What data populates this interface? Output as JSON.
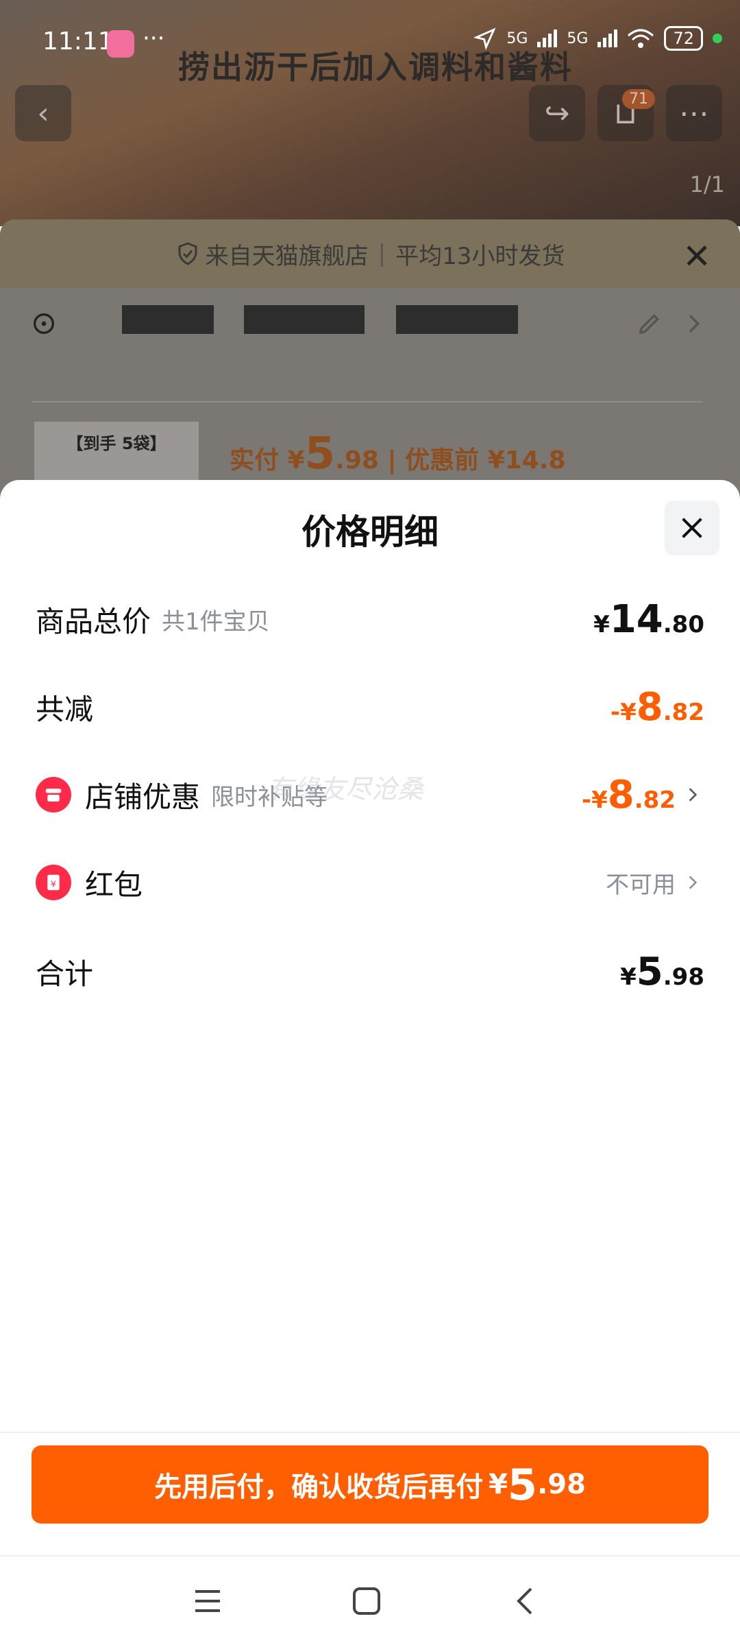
{
  "status_bar": {
    "time": "11:11",
    "more": "···",
    "network1": "5G",
    "network2": "5G",
    "battery": "72"
  },
  "background": {
    "video_caption": "捞出沥干后加入调料和酱料",
    "cart_count": "71",
    "page_indicator": "1/1",
    "shop_notice": {
      "source": "来自天猫旗舰店",
      "shipping": "平均13小时发货"
    },
    "product_tag": "【到手 5袋】",
    "actual_pay_label": "实付",
    "actual_pay_currency": "¥",
    "actual_pay_int": "5",
    "actual_pay_dec": ".98",
    "original_price": "优惠前 ¥14.8"
  },
  "sheet": {
    "title": "价格明细",
    "rows": {
      "total": {
        "label": "商品总价",
        "sub": "共1件宝贝",
        "currency": "¥",
        "int": "14",
        "dec": ".80"
      },
      "discount": {
        "label": "共减",
        "currency": "-¥",
        "int": "8",
        "dec": ".82"
      },
      "shop_discount": {
        "label": "店铺优惠",
        "sub": "限时补贴等",
        "currency": "-¥",
        "int": "8",
        "dec": ".82"
      },
      "red_packet": {
        "label": "红包",
        "value": "不可用"
      },
      "sum": {
        "label": "合计",
        "currency": "¥",
        "int": "5",
        "dec": ".98"
      }
    },
    "watermark": "有缘友尽沧桑"
  },
  "pay_button": {
    "text": "先用后付，确认收货后再付",
    "currency": "¥",
    "int": "5",
    "dec": ".98"
  },
  "colors": {
    "accent": "#ff5f00",
    "discount": "#ff5e00",
    "icon_red": "#ff2b49"
  }
}
